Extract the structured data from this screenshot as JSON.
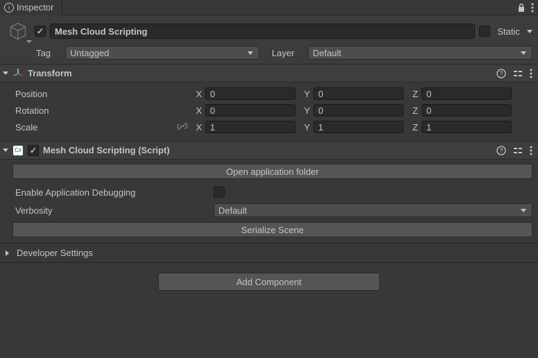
{
  "tab": {
    "title": "Inspector"
  },
  "gameObject": {
    "name": "Mesh Cloud Scripting",
    "static_label": "Static",
    "tag_label": "Tag",
    "tag_value": "Untagged",
    "layer_label": "Layer",
    "layer_value": "Default"
  },
  "transform": {
    "title": "Transform",
    "position_label": "Position",
    "rotation_label": "Rotation",
    "scale_label": "Scale",
    "x_label": "X",
    "y_label": "Y",
    "z_label": "Z",
    "position": {
      "x": "0",
      "y": "0",
      "z": "0"
    },
    "rotation": {
      "x": "0",
      "y": "0",
      "z": "0"
    },
    "scale": {
      "x": "1",
      "y": "1",
      "z": "1"
    }
  },
  "script": {
    "title": "Mesh Cloud Scripting (Script)",
    "open_folder_btn": "Open application folder",
    "enable_debug_label": "Enable Application Debugging",
    "verbosity_label": "Verbosity",
    "verbosity_value": "Default",
    "serialize_btn": "Serialize Scene"
  },
  "developer": {
    "title": "Developer Settings"
  },
  "add_component_label": "Add Component"
}
